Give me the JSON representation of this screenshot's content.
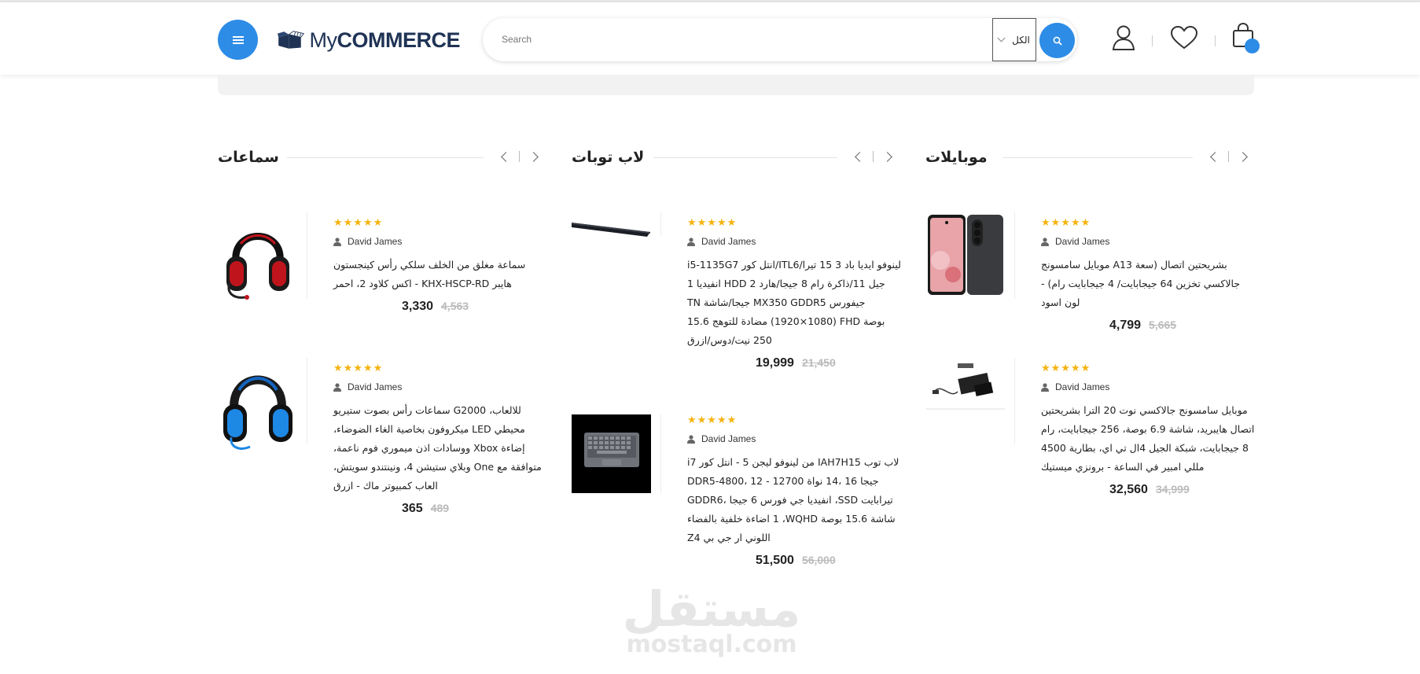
{
  "header": {
    "logo_text_my": "My",
    "logo_text_commerce": "COMMERCE",
    "search_placeholder": "Search",
    "category_select": "الكل",
    "icons": [
      "menu-icon",
      "search-icon",
      "user-icon",
      "heart-icon",
      "cart-icon"
    ]
  },
  "columns": [
    {
      "title": "موبايلات",
      "products": [
        {
          "rating": "★★★★★",
          "author": "David James",
          "title": "بشريحتين اتصال (سعة A13 موبايل سامسونج جالاكسي تخزين 64 جيجابايت/ 4 جيجابايت رام) - لون اسود",
          "price": "4,799",
          "old_price": "5,665"
        },
        {
          "rating": "★★★★★",
          "author": "David James",
          "title": "موبايل سامسونج جالاكسي نوت 20 الترا بشريحتين اتصال هايبريد، شاشة 6.9 بوصة، 256 جيجابايت، رام 8 جيجابايت، شبكة الجيل 4ال تي اي، بطارية 4500 مللي امبير في الساعة - برونزي ميستيك",
          "price": "32,560",
          "old_price": "34,999"
        }
      ]
    },
    {
      "title": "لاب توبات",
      "products": [
        {
          "rating": "★★★★★",
          "author": "David James",
          "title": "i5-1135G7 انتل كور/ITL6لينوفو ايديا باد 3 15 تيرا/انفيديا 1 HDD جيل 11/ذاكرة رام 8 جيجا/هارد 2 TN جيجا/شاشة MX350 GDDR5 جيفورس (1080×1920) مضادة للتوهج 15.6 FHD بوصة 250 نيت/دوس/ازرق",
          "price": "19,999",
          "old_price": "21,450"
        },
        {
          "rating": "★★★★★",
          "author": "David James",
          "title": "i7 من لينوفو ليجن 5 - انتل كور IAH7Hلاب توب 15 DDR5-4800، جيجا 16 ،14 نواة 12700 - 12 GDDR6، انفيديا جي فورس 6 جيجا ،SSD تيرابايت 1 اضاءة خلفية بالفضاء ،WQHD شاشة 15.6 بوصة Zاللوني ار جي بي 4",
          "price": "51,500",
          "old_price": "56,000"
        }
      ]
    },
    {
      "title": "سماعات",
      "products": [
        {
          "rating": "★★★★★",
          "author": "David James",
          "title": "سماعة مغلق من الخلف سلكي رأس كينجستون هايبر KHX-HSCP-RD - اكس كلاود 2، احمر",
          "price": "3,330",
          "old_price": "4,563"
        },
        {
          "rating": "★★★★★",
          "author": "David James",
          "title": "للالعاب، G2000 سماعات رأس بصوت ستيريو محيطي LED ميكروفون بخاصية الغاء الضوضاء، إضاءة Xbox ووسادات اذن ميموري فوم ناعمة، متوافقة مع One وبلاي ستيشن 4، ونينتندو سويتش، العاب كمبيوتر ماك - ازرق",
          "price": "365",
          "old_price": "489"
        }
      ]
    }
  ],
  "watermark": {
    "arabic": "مستقل",
    "latin": "mostaql.com"
  }
}
